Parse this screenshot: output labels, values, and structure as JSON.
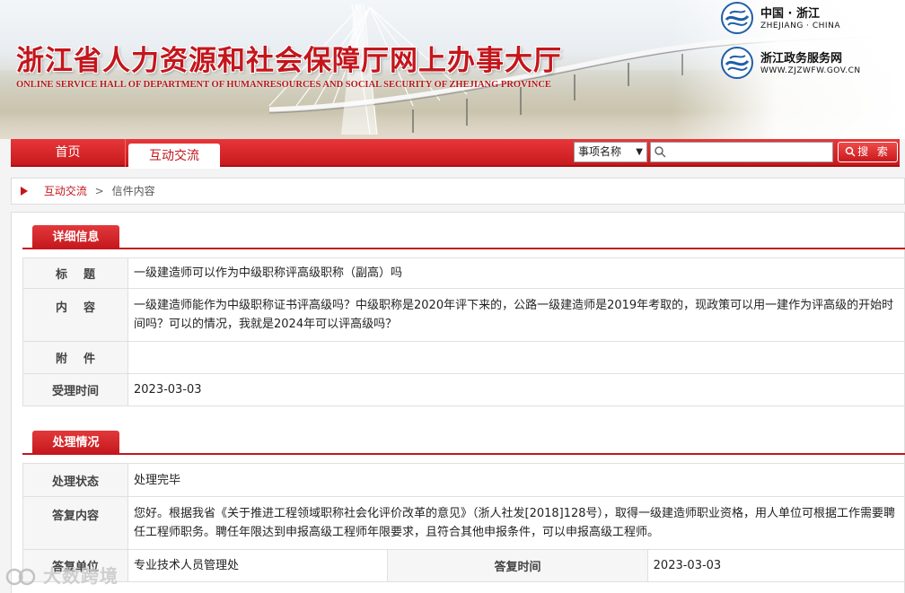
{
  "header": {
    "title_cn": "浙江省人力资源和社会保障厅网上办事大厅",
    "title_en": "ONLINE SERVICE HALL OF DEPARTMENT OF HUMANRESOURCES AND SOCIAL SECURITY OF ZHEJIANG PROVINCE",
    "gov_links": [
      {
        "cn": "中国 · 浙江",
        "en": "ZHEJIANG · CHINA",
        "icon": "zhejiang-logo-icon"
      },
      {
        "cn": "浙江政务服务网",
        "en": "WWW.ZJZWFW.GOV.CN",
        "icon": "zhejiang-service-logo-icon"
      }
    ]
  },
  "nav": {
    "tabs": [
      {
        "label": "首页",
        "active": false
      },
      {
        "label": "互动交流",
        "active": true
      }
    ],
    "search": {
      "select_value": "事项名称",
      "input_value": "",
      "button_label": "搜 索"
    }
  },
  "breadcrumb": {
    "link": "互动交流",
    "separator": ">",
    "current": "信件内容"
  },
  "details": {
    "section_title": "详细信息",
    "rows": [
      {
        "label": "标    题",
        "value": "一级建造师可以作为中级职称评高级职称（副高）吗"
      },
      {
        "label": "内    容",
        "value": "一级建造师能作为中级职称证书评高级吗？中级职称是2020年评下来的，公路一级建造师是2019年考取的，现政策可以用一建作为评高级的开始时间吗？可以的情况，我就是2024年可以评高级吗？"
      },
      {
        "label": "附    件",
        "value": ""
      },
      {
        "label": "受理时间",
        "value": "2023-03-03"
      }
    ]
  },
  "processing": {
    "section_title": "处理情况",
    "status_label": "处理状态",
    "status_value": "处理完毕",
    "reply_label": "答复内容",
    "reply_value": "您好。根据我省《关于推进工程领域职称社会化评价改革的意见》（浙人社发[2018]128号），取得一级建造师职业资格，用人单位可根据工作需要聘任工程师职务。聘任年限达到申报高级工程师年限要求，且符合其他申报条件，可以申报高级工程师。",
    "unit_label": "答复单位",
    "unit_value": "专业技术人员管理处",
    "time_label": "答复时间",
    "time_value": "2023-03-03"
  },
  "watermark": {
    "text": "大数跨境"
  },
  "colors": {
    "brand_red": "#c3161c",
    "nav_red": "#d92b2e",
    "label_bg": "#f6f6f6"
  }
}
